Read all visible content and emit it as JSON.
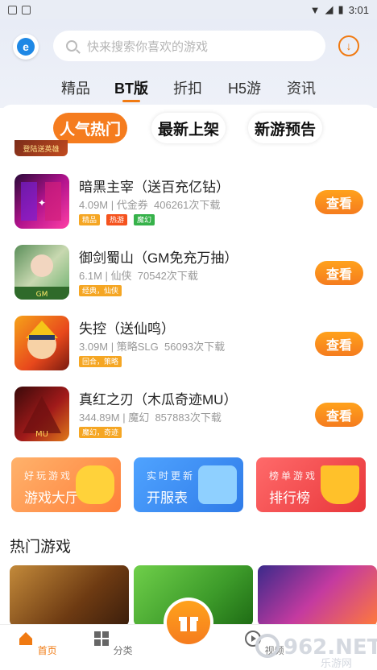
{
  "status": {
    "time": "3:01"
  },
  "search": {
    "placeholder": "快来搜索你喜欢的游戏"
  },
  "tabs": [
    {
      "label": "精品"
    },
    {
      "label": "BT版"
    },
    {
      "label": "折扣"
    },
    {
      "label": "H5游"
    },
    {
      "label": "资讯"
    }
  ],
  "subtabs": [
    {
      "label": "人气热门"
    },
    {
      "label": "最新上架"
    },
    {
      "label": "新游预告"
    }
  ],
  "partial_game": {
    "banner": "登陆送英雄"
  },
  "games": [
    {
      "title": "暗黑主宰（送百充亿钻）",
      "size": "4.09M",
      "category": "代金券",
      "downloads": "406261次下载",
      "tags": [
        "精品",
        "热游",
        "魔幻"
      ],
      "button": "查看"
    },
    {
      "title": "御剑蜀山（GM免充万抽）",
      "size": "6.1M",
      "category": "仙侠",
      "downloads": "70542次下载",
      "tags": [
        "经典，仙侠"
      ],
      "button": "查看"
    },
    {
      "title": "失控（送仙鸣）",
      "size": "3.09M",
      "category": "策略SLG",
      "downloads": "56093次下载",
      "tags": [
        "回合，策略"
      ],
      "button": "查看"
    },
    {
      "title": "真红之刃（木瓜奇迹MU）",
      "size": "344.89M",
      "category": "魔幻",
      "downloads": "857883次下载",
      "tags": [
        "魔幻，奇迹"
      ],
      "button": "查看"
    }
  ],
  "feature_cards": [
    {
      "small": "好玩游戏",
      "big": "游戏大厅"
    },
    {
      "small": "实时更新",
      "big": "开服表"
    },
    {
      "small": "榜单游戏",
      "big": "排行榜"
    }
  ],
  "hot_section": {
    "title": "热门游戏"
  },
  "nav": [
    {
      "label": "首页"
    },
    {
      "label": "分类"
    },
    {
      "label": "视频"
    }
  ],
  "colors": {
    "accent": "#f57c1e",
    "brand_blue": "#1e88e5"
  }
}
